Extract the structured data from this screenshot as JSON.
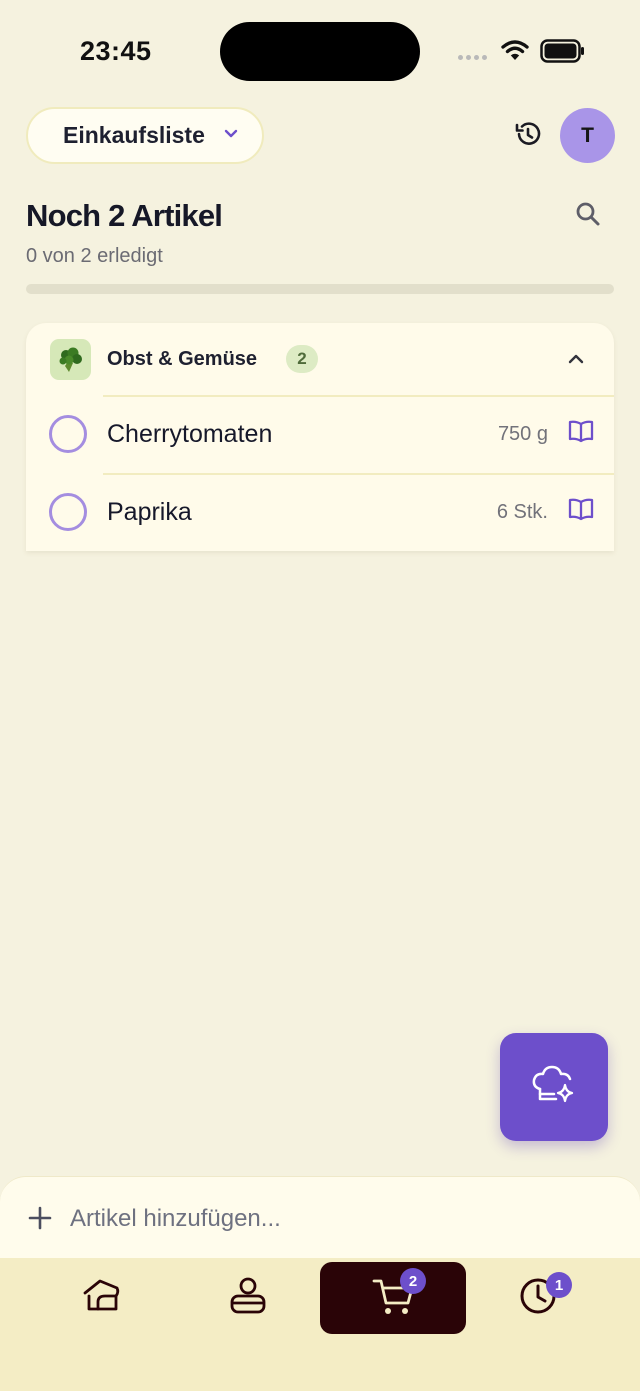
{
  "status_bar": {
    "time": "23:45"
  },
  "header": {
    "list_selector": "Einkaufsliste",
    "avatar_initial": "T"
  },
  "summary": {
    "title": "Noch 2 Artikel",
    "progress_text": "0 von 2 erledigt",
    "progress_fraction": 0
  },
  "category": {
    "name": "Obst & Gemüse",
    "count": "2",
    "icon": "broccoli-icon",
    "items": [
      {
        "name": "Cherrytomaten",
        "quantity": "750 g",
        "checked": false
      },
      {
        "name": "Paprika",
        "quantity": "6 Stk.",
        "checked": false
      }
    ]
  },
  "add_item": {
    "placeholder": "Artikel hinzufügen..."
  },
  "tabbar": {
    "tabs": [
      {
        "icon": "home-icon",
        "active": false
      },
      {
        "icon": "pantry-icon",
        "active": false
      },
      {
        "icon": "cart-icon",
        "active": true,
        "badge": "2"
      },
      {
        "icon": "clock-icon",
        "active": false,
        "badge": "1"
      }
    ]
  },
  "colors": {
    "background": "#F5F2DF",
    "accent": "#6D4FCB",
    "avatar": "#A995E8",
    "active_tab": "#2A0407"
  }
}
